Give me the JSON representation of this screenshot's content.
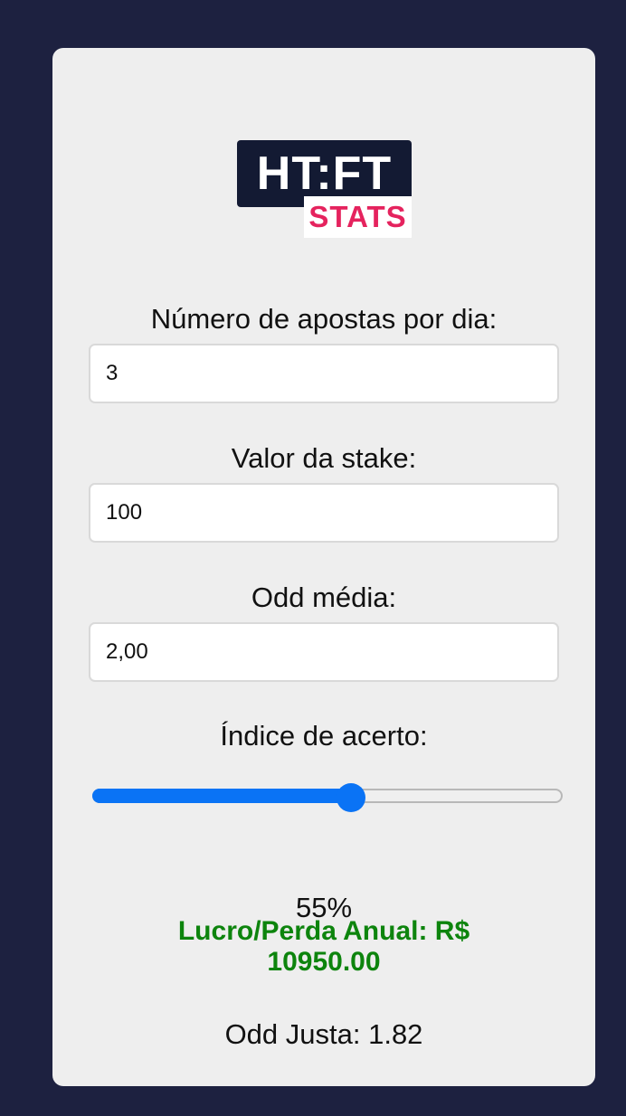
{
  "logo": {
    "top_text": "HT:FT",
    "bottom_text": "STATS"
  },
  "form": {
    "bets_per_day": {
      "label": "Número de apostas por dia:",
      "value": "3"
    },
    "stake": {
      "label": "Valor da stake:",
      "value": "100"
    },
    "avg_odd": {
      "label": "Odd média:",
      "value": "2,00"
    },
    "hit_rate": {
      "label": "Índice de acerto:",
      "value": 55,
      "display": "55%"
    }
  },
  "results": {
    "annual_line1": "Lucro/Perda Anual: R$",
    "annual_line2": "10950.00",
    "fair_odd": "Odd Justa: 1.82"
  },
  "colors": {
    "background": "#1d2140",
    "card": "#eeeeee",
    "accent": "#0a73f5",
    "profit": "#0d840d",
    "logo_dark": "#131a33",
    "logo_pink": "#e5235e"
  }
}
